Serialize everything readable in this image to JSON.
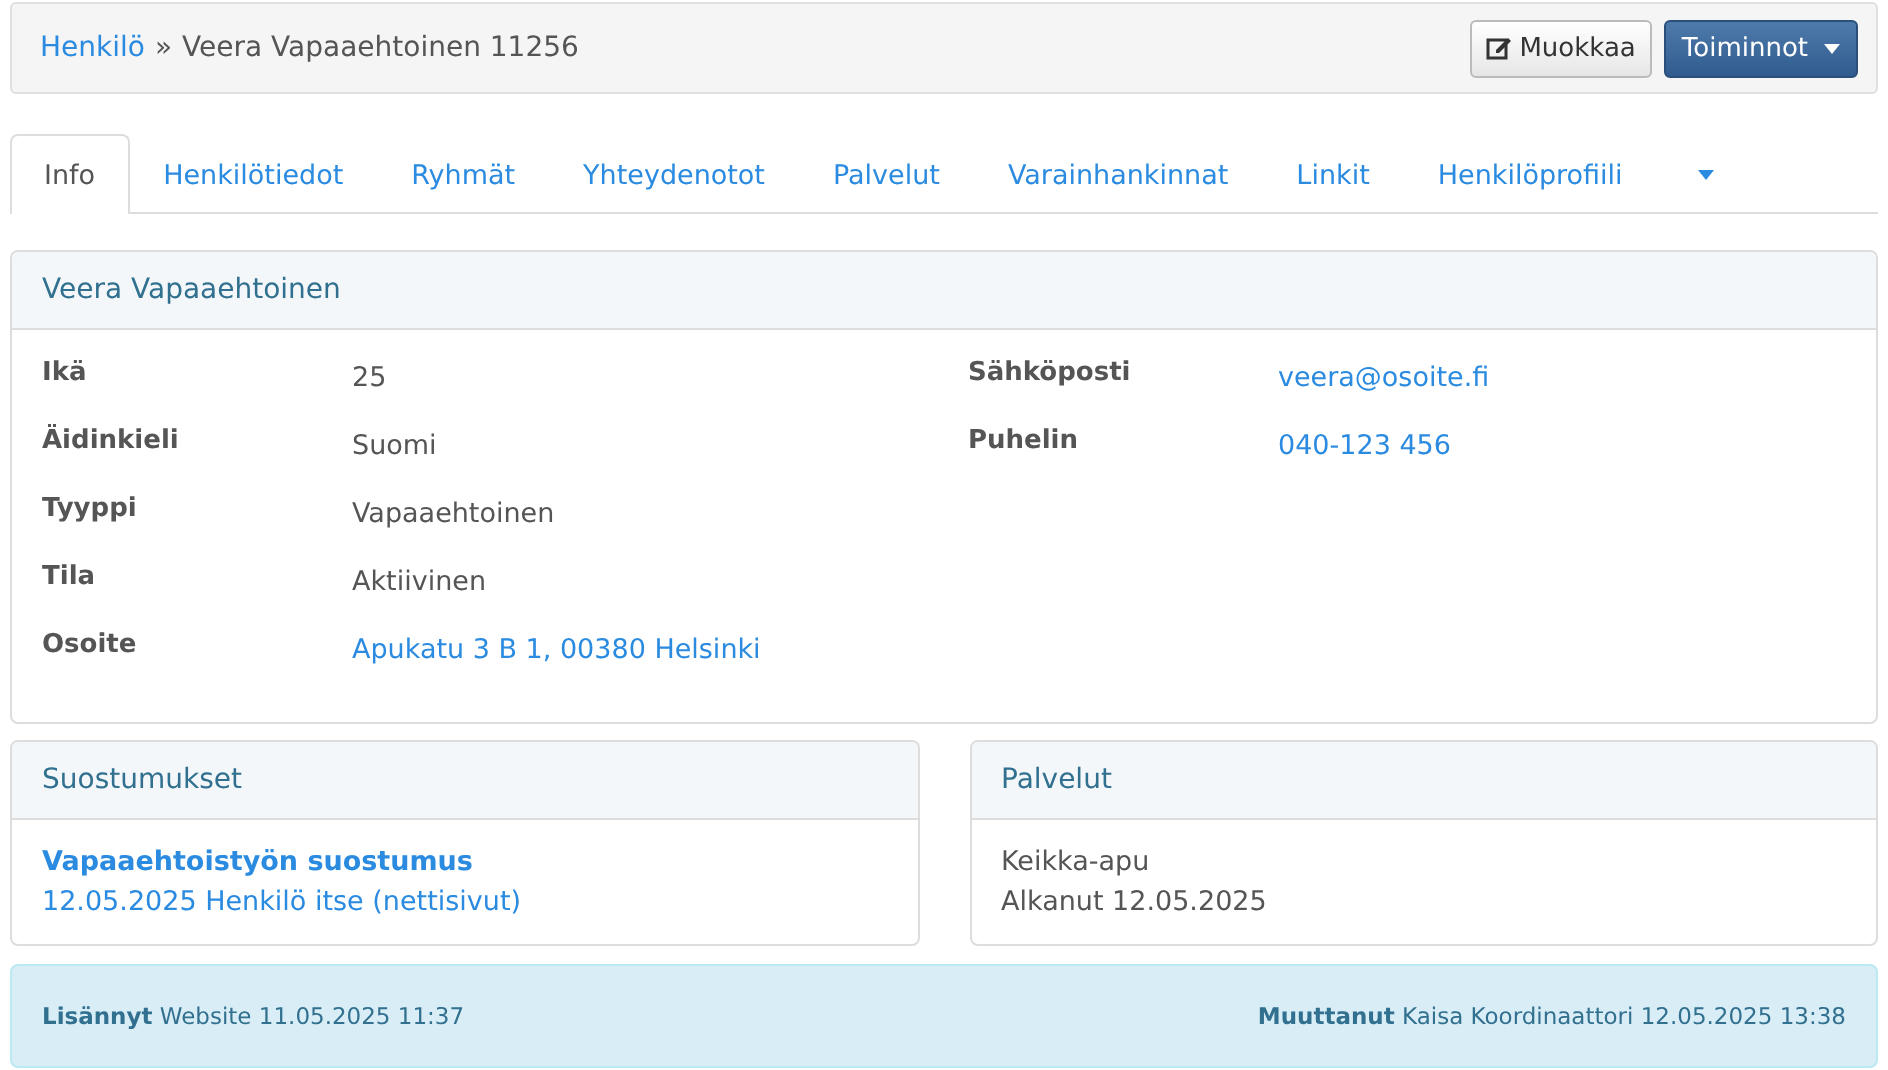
{
  "breadcrumb": {
    "link": "Henkilö",
    "separator": "»",
    "current": "Veera Vapaaehtoinen 11256"
  },
  "buttons": [
    {
      "label": "Muokkaa",
      "kind": "default"
    },
    {
      "label": "Toiminnot",
      "kind": "dropdown"
    }
  ],
  "tabs": [
    {
      "label": "Info",
      "selected": true
    },
    {
      "label": "Henkilötiedot",
      "selected": false
    },
    {
      "label": "Ryhmät",
      "selected": false
    },
    {
      "label": "Yhteydenotot",
      "selected": false
    },
    {
      "label": "Palvelut",
      "selected": false
    },
    {
      "label": "Varainhankinnat",
      "selected": false
    },
    {
      "label": "Linkit",
      "selected": false
    },
    {
      "label": "Henkilöprofiili",
      "selected": false
    }
  ],
  "info": {
    "title": "Veera Vapaaehtoinen",
    "left": [
      {
        "label": "Ikä",
        "value": "25",
        "kind": "text"
      },
      {
        "label": "Äidinkieli",
        "value": "Suomi",
        "kind": "text"
      },
      {
        "label": "Tyyppi",
        "value": "Vapaaehtoinen",
        "kind": "text"
      },
      {
        "label": "Tila",
        "value": "Aktiivinen",
        "kind": "text"
      },
      {
        "label": "Osoite",
        "value": "Apukatu 3 B 1, 00380 Helsinki",
        "kind": "link"
      }
    ],
    "right": [
      {
        "label": "Sähköposti",
        "value": "veera@osoite.fi",
        "kind": "link"
      },
      {
        "label": "Puhelin",
        "value": "040-123 456",
        "kind": "link"
      }
    ]
  },
  "consents": {
    "title": "Suostumukset",
    "items": [
      {
        "name": "Vapaaehtoistyön suostumus",
        "detail": "12.05.2025 Henkilö itse (nettisivut)"
      }
    ]
  },
  "services": {
    "title": "Palvelut",
    "lines": [
      "Keikka-apu",
      "Alkanut 12.05.2025"
    ]
  },
  "footer": {
    "added": "**Lisännyt** Website 11.05.2025 11:37",
    "modified": "**Muuttanut** Kaisa Koordinaattori 12.05.2025 13:38"
  }
}
